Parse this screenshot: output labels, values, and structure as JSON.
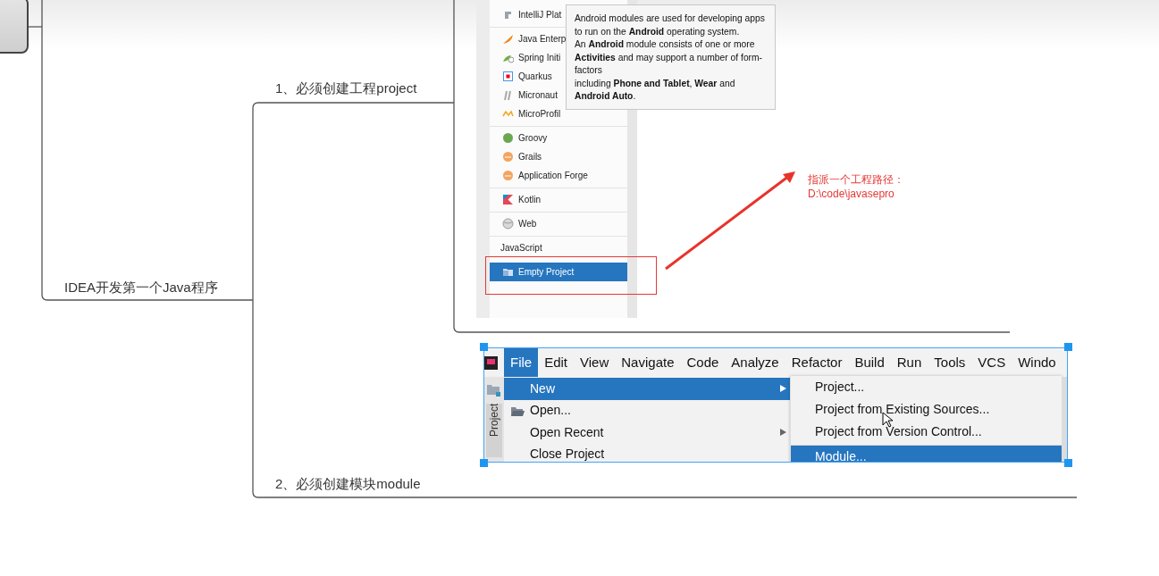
{
  "topic": {
    "text": "IDEA开发第一个Java程序",
    "branches": [
      {
        "text": "1、必须创建工程project",
        "project_types": {
          "groups": [
            {
              "items": [
                {
                  "label": "IntelliJ Plat",
                  "selected": false
                }
              ]
            },
            {
              "items": [
                {
                  "label": "Java Enterp",
                  "selected": false
                },
                {
                  "label": "Spring Initi",
                  "selected": false
                },
                {
                  "label": "Quarkus",
                  "selected": false
                },
                {
                  "label": "Micronaut",
                  "selected": false
                },
                {
                  "label": "MicroProfil",
                  "selected": false
                }
              ]
            },
            {
              "items": [
                {
                  "label": "Groovy",
                  "selected": false
                },
                {
                  "label": "Grails",
                  "selected": false
                },
                {
                  "label": "Application Forge",
                  "selected": false
                }
              ]
            },
            {
              "items": [
                {
                  "label": "Kotlin",
                  "selected": false
                }
              ]
            },
            {
              "items": [
                {
                  "label": "Web",
                  "selected": false
                }
              ]
            },
            {
              "header": "JavaScript",
              "items": [
                {
                  "label": "Empty Project",
                  "selected": true
                }
              ]
            }
          ],
          "tooltip": [
            "Android modules are used for developing apps to run on the **Android** operating system.",
            "An **Android** module consists of one or more **Activities** and may support a number of form-factors",
            "including **Phone and Tablet**, **Wear** and **Android Auto**."
          ]
        },
        "annotation": [
          "指派一个工程路径：",
          "D:\\code\\javasepro"
        ]
      },
      {
        "text": "2、必须创建模块module",
        "ide_menu": {
          "menubar": [
            {
              "label": "File",
              "selected": true
            },
            {
              "label": "Edit",
              "selected": false
            },
            {
              "label": "View",
              "selected": false
            },
            {
              "label": "Navigate",
              "selected": false
            },
            {
              "label": "Code",
              "selected": false
            },
            {
              "label": "Analyze",
              "selected": false
            },
            {
              "label": "Refactor",
              "selected": false
            },
            {
              "label": "Build",
              "selected": false
            },
            {
              "label": "Run",
              "selected": false
            },
            {
              "label": "Tools",
              "selected": false
            },
            {
              "label": "VCS",
              "selected": false
            },
            {
              "label": "Windo",
              "selected": false
            }
          ],
          "file_menu": [
            {
              "label": "New",
              "selected": true,
              "submenu": true,
              "has_icon": false
            },
            {
              "label": "Open...",
              "selected": false,
              "submenu": false,
              "has_icon": true
            },
            {
              "label": "Open Recent",
              "selected": false,
              "submenu": true,
              "has_icon": false
            },
            {
              "label": "Close Project",
              "selected": false,
              "submenu": false,
              "has_icon": false
            }
          ],
          "new_submenu": [
            {
              "label": "Project...",
              "selected": false,
              "separator_before": false
            },
            {
              "label": "Project from Existing Sources...",
              "selected": false,
              "separator_before": false
            },
            {
              "label": "Project from Version Control...",
              "selected": false,
              "separator_before": false
            },
            {
              "label": "Module...",
              "selected": true,
              "separator_before": true
            }
          ],
          "side_tab": "Project"
        }
      }
    ]
  }
}
